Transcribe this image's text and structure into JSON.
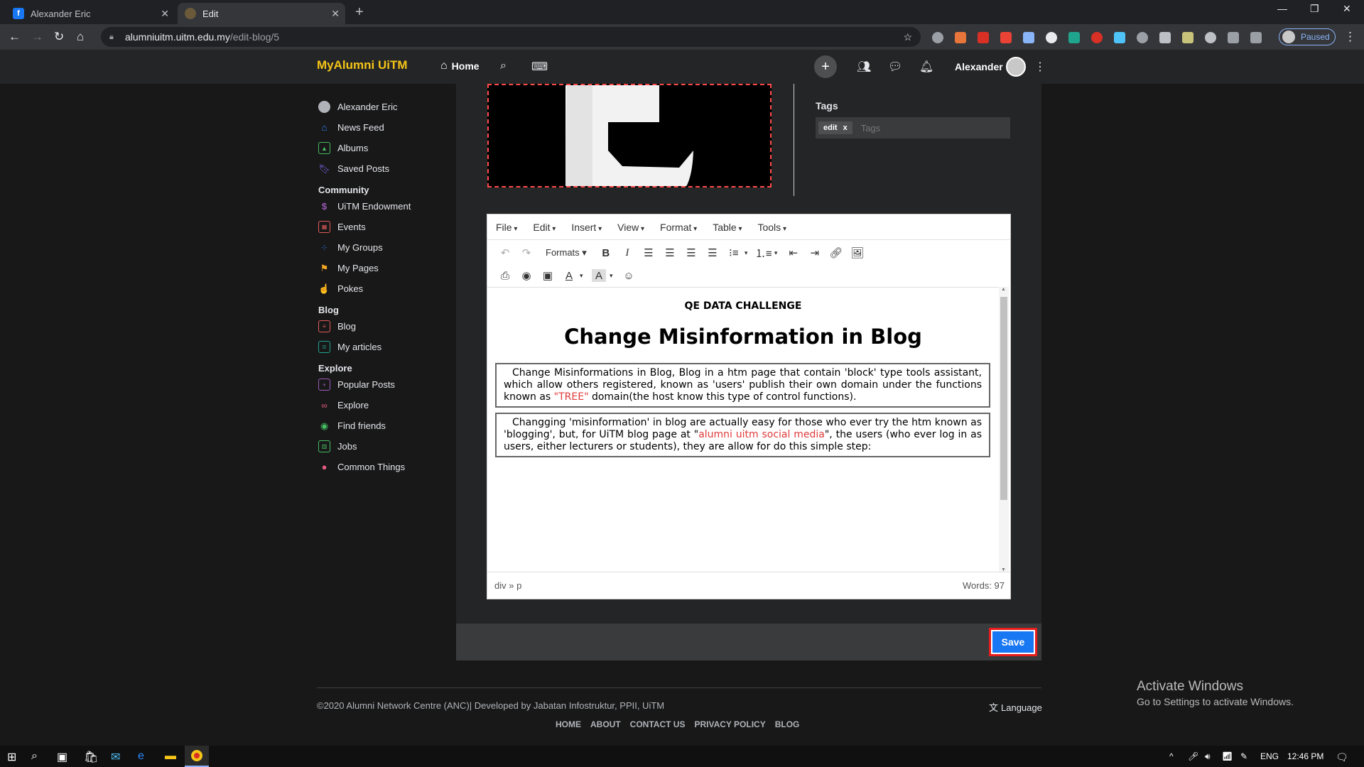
{
  "browser": {
    "tabs": [
      {
        "title": "Alexander Eric",
        "favicon": "f"
      },
      {
        "title": "Edit",
        "favicon": "e"
      }
    ],
    "url_domain": "alumniuitm.uitm.edu.my",
    "url_path": "/edit-blog/5",
    "profile_status": "Paused"
  },
  "header": {
    "logo": "MyAlumni UiTM",
    "home_label": "Home",
    "user_name": "Alexander"
  },
  "sidebar": {
    "top_items": [
      {
        "label": "Alexander Eric",
        "icon": "avatar-icon",
        "color": "#b0b3b8"
      },
      {
        "label": "News Feed",
        "icon": "home-icon",
        "color": "#2d88ff"
      },
      {
        "label": "Albums",
        "icon": "image-icon",
        "color": "#45bd62"
      },
      {
        "label": "Saved Posts",
        "icon": "bookmark-icon",
        "color": "#7b68ee"
      }
    ],
    "community_heading": "Community",
    "community_items": [
      {
        "label": "UiTM Endowment",
        "icon": "dollar-icon",
        "color": "#9b59b6"
      },
      {
        "label": "Events",
        "icon": "calendar-icon",
        "color": "#e45b5b"
      },
      {
        "label": "My Groups",
        "icon": "groups-icon",
        "color": "#2d88ff"
      },
      {
        "label": "My Pages",
        "icon": "flag-icon",
        "color": "#f5a623"
      },
      {
        "label": "Pokes",
        "icon": "hand-icon",
        "color": "#1fa58e"
      }
    ],
    "blog_heading": "Blog",
    "blog_items": [
      {
        "label": "Blog",
        "icon": "blog-icon",
        "color": "#e45b5b"
      },
      {
        "label": "My articles",
        "icon": "document-icon",
        "color": "#1fa58e"
      }
    ],
    "explore_heading": "Explore",
    "explore_items": [
      {
        "label": "Popular Posts",
        "icon": "popular-icon",
        "color": "#9b59b6"
      },
      {
        "label": "Explore",
        "icon": "glasses-icon",
        "color": "#e45b82"
      },
      {
        "label": "Find friends",
        "icon": "location-icon",
        "color": "#45bd62"
      },
      {
        "label": "Jobs",
        "icon": "briefcase-icon",
        "color": "#45bd62"
      },
      {
        "label": "Common Things",
        "icon": "common-icon",
        "color": "#e45b82"
      }
    ]
  },
  "tags": {
    "label": "Tags",
    "chips": [
      "edit"
    ],
    "chip_remove": "x",
    "placeholder": "Tags"
  },
  "editor": {
    "menus": [
      "File",
      "Edit",
      "Insert",
      "View",
      "Format",
      "Table",
      "Tools"
    ],
    "formats_label": "Formats",
    "challenge": "QE DATA CHALLENGE",
    "title": "Change Misinformation in Blog",
    "p1_a": "Change Misinformations in Blog, Blog in a htm page that contain 'block' type tools assistant, which allow others registered, known as 'users' publish their own domain under the functions known as ",
    "p1_red": "\"TREE\"",
    "p1_b": " domain(the host know this type of control functions).",
    "p2_a": "Changging 'misinformation' in blog are actually easy for those who ever try the htm known as 'blogging', but, for UiTM blog page at \"",
    "p2_red": "alumni uitm social media",
    "p2_b": "\", the users (who ever log in as users, either lecturers or students), they are allow for do this simple step:",
    "path": "div » p",
    "words": "Words: 97"
  },
  "save_label": "Save",
  "footer": {
    "copyright": "©2020 Alumni Network Centre (ANC)| Developed by Jabatan Infostruktur, PPII, UiTM",
    "language": "Language",
    "links": [
      "HOME",
      "ABOUT",
      "CONTACT US",
      "PRIVACY POLICY",
      "BLOG"
    ]
  },
  "watermark": {
    "line1": "Activate Windows",
    "line2": "Go to Settings to activate Windows."
  },
  "taskbar": {
    "lang": "ENG",
    "time": "12:46 PM"
  }
}
